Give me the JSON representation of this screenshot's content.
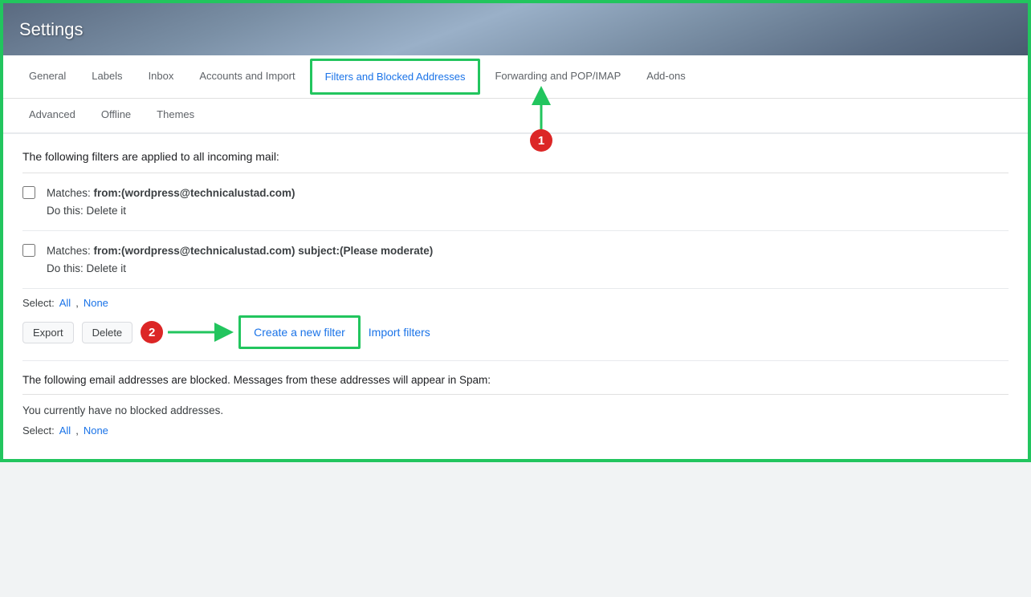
{
  "header": {
    "title": "Settings"
  },
  "nav": {
    "tabs_row1": [
      {
        "label": "General",
        "active": false,
        "highlighted": false
      },
      {
        "label": "Labels",
        "active": false,
        "highlighted": false
      },
      {
        "label": "Inbox",
        "active": false,
        "highlighted": false
      },
      {
        "label": "Accounts and Import",
        "active": false,
        "highlighted": false
      },
      {
        "label": "Filters and Blocked Addresses",
        "active": true,
        "highlighted": true
      },
      {
        "label": "Forwarding and POP/IMAP",
        "active": false,
        "highlighted": false
      },
      {
        "label": "Add-ons",
        "active": false,
        "highlighted": false
      }
    ],
    "tabs_row2": [
      {
        "label": "Advanced",
        "active": false
      },
      {
        "label": "Offline",
        "active": false
      },
      {
        "label": "Themes",
        "active": false
      }
    ]
  },
  "filters_section": {
    "title": "The following filters are applied to all incoming mail:",
    "filters": [
      {
        "matches_label": "Matches: ",
        "matches_value": "from:(wordpress@technicalustad.com)",
        "action_label": "Do this: ",
        "action_value": "Delete it"
      },
      {
        "matches_label": "Matches: ",
        "matches_value": "from:(wordpress@technicalustad.com) subject:(Please moderate)",
        "action_label": "Do this: ",
        "action_value": "Delete it"
      }
    ],
    "select_label": "Select: ",
    "select_all": "All",
    "select_comma": ", ",
    "select_none": "None",
    "export_btn": "Export",
    "delete_btn": "Delete",
    "create_filter_link": "Create a new filter",
    "import_filter_link": "Import filters"
  },
  "blocked_section": {
    "title": "The following email addresses are blocked. Messages from these addresses will appear in Spam:",
    "no_blocked_msg": "You currently have no blocked addresses.",
    "select_label": "Select: ",
    "select_all": "All",
    "select_comma": ", ",
    "select_none": "None"
  },
  "annotations": {
    "badge1": "1",
    "badge2": "2"
  }
}
